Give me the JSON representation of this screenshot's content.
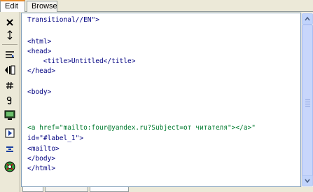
{
  "tabs": [
    {
      "label": "Edit",
      "active": true
    },
    {
      "label": "Browse",
      "active": false
    }
  ],
  "toolbar": [
    {
      "icon": "close-icon"
    },
    {
      "icon": "resize-vertical-icon"
    },
    {
      "icon": "word-wrap-icon"
    },
    {
      "icon": "indent-icon"
    },
    {
      "icon": "hash-icon"
    },
    {
      "icon": "paragraph-icon"
    },
    {
      "icon": "monitor-icon"
    },
    {
      "icon": "play-icon"
    },
    {
      "icon": "heading-icon"
    },
    {
      "icon": "globe-icon"
    }
  ],
  "code_lines": [
    "Transitional//EN\">",
    "",
    "<html>",
    "<head>",
    "    <title>Untitled</title>",
    "</head>",
    "",
    "<body>",
    "",
    "",
    "",
    "<a href=\"mailto:four@yandex.ru?Subject=от читателя\"></a>\"",
    "id=\"#label_1\">",
    "<mailto>",
    "</body>",
    "</html>"
  ],
  "highlighted_line_index": 11,
  "colors": {
    "tag": "#000080",
    "link": "#007a2e",
    "active_tab_accent": "#e68b2c"
  }
}
